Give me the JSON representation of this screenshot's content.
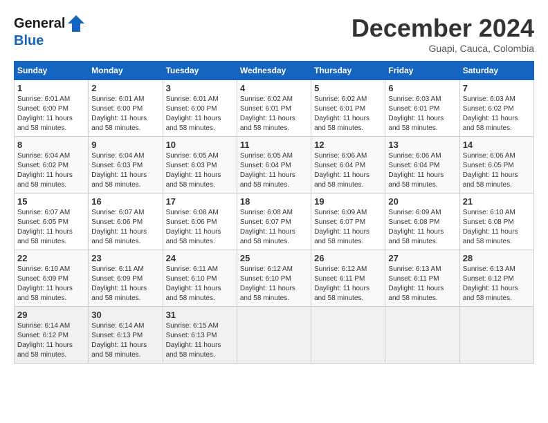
{
  "header": {
    "logo_line1": "General",
    "logo_line2": "Blue",
    "month_title": "December 2024",
    "location": "Guapi, Cauca, Colombia"
  },
  "days_of_week": [
    "Sunday",
    "Monday",
    "Tuesday",
    "Wednesday",
    "Thursday",
    "Friday",
    "Saturday"
  ],
  "weeks": [
    [
      {
        "day": "1",
        "sunrise": "6:01 AM",
        "sunset": "6:00 PM",
        "daylight": "11 hours and 58 minutes."
      },
      {
        "day": "2",
        "sunrise": "6:01 AM",
        "sunset": "6:00 PM",
        "daylight": "11 hours and 58 minutes."
      },
      {
        "day": "3",
        "sunrise": "6:01 AM",
        "sunset": "6:00 PM",
        "daylight": "11 hours and 58 minutes."
      },
      {
        "day": "4",
        "sunrise": "6:02 AM",
        "sunset": "6:01 PM",
        "daylight": "11 hours and 58 minutes."
      },
      {
        "day": "5",
        "sunrise": "6:02 AM",
        "sunset": "6:01 PM",
        "daylight": "11 hours and 58 minutes."
      },
      {
        "day": "6",
        "sunrise": "6:03 AM",
        "sunset": "6:01 PM",
        "daylight": "11 hours and 58 minutes."
      },
      {
        "day": "7",
        "sunrise": "6:03 AM",
        "sunset": "6:02 PM",
        "daylight": "11 hours and 58 minutes."
      }
    ],
    [
      {
        "day": "8",
        "sunrise": "6:04 AM",
        "sunset": "6:02 PM",
        "daylight": "11 hours and 58 minutes."
      },
      {
        "day": "9",
        "sunrise": "6:04 AM",
        "sunset": "6:03 PM",
        "daylight": "11 hours and 58 minutes."
      },
      {
        "day": "10",
        "sunrise": "6:05 AM",
        "sunset": "6:03 PM",
        "daylight": "11 hours and 58 minutes."
      },
      {
        "day": "11",
        "sunrise": "6:05 AM",
        "sunset": "6:04 PM",
        "daylight": "11 hours and 58 minutes."
      },
      {
        "day": "12",
        "sunrise": "6:06 AM",
        "sunset": "6:04 PM",
        "daylight": "11 hours and 58 minutes."
      },
      {
        "day": "13",
        "sunrise": "6:06 AM",
        "sunset": "6:04 PM",
        "daylight": "11 hours and 58 minutes."
      },
      {
        "day": "14",
        "sunrise": "6:06 AM",
        "sunset": "6:05 PM",
        "daylight": "11 hours and 58 minutes."
      }
    ],
    [
      {
        "day": "15",
        "sunrise": "6:07 AM",
        "sunset": "6:05 PM",
        "daylight": "11 hours and 58 minutes."
      },
      {
        "day": "16",
        "sunrise": "6:07 AM",
        "sunset": "6:06 PM",
        "daylight": "11 hours and 58 minutes."
      },
      {
        "day": "17",
        "sunrise": "6:08 AM",
        "sunset": "6:06 PM",
        "daylight": "11 hours and 58 minutes."
      },
      {
        "day": "18",
        "sunrise": "6:08 AM",
        "sunset": "6:07 PM",
        "daylight": "11 hours and 58 minutes."
      },
      {
        "day": "19",
        "sunrise": "6:09 AM",
        "sunset": "6:07 PM",
        "daylight": "11 hours and 58 minutes."
      },
      {
        "day": "20",
        "sunrise": "6:09 AM",
        "sunset": "6:08 PM",
        "daylight": "11 hours and 58 minutes."
      },
      {
        "day": "21",
        "sunrise": "6:10 AM",
        "sunset": "6:08 PM",
        "daylight": "11 hours and 58 minutes."
      }
    ],
    [
      {
        "day": "22",
        "sunrise": "6:10 AM",
        "sunset": "6:09 PM",
        "daylight": "11 hours and 58 minutes."
      },
      {
        "day": "23",
        "sunrise": "6:11 AM",
        "sunset": "6:09 PM",
        "daylight": "11 hours and 58 minutes."
      },
      {
        "day": "24",
        "sunrise": "6:11 AM",
        "sunset": "6:10 PM",
        "daylight": "11 hours and 58 minutes."
      },
      {
        "day": "25",
        "sunrise": "6:12 AM",
        "sunset": "6:10 PM",
        "daylight": "11 hours and 58 minutes."
      },
      {
        "day": "26",
        "sunrise": "6:12 AM",
        "sunset": "6:11 PM",
        "daylight": "11 hours and 58 minutes."
      },
      {
        "day": "27",
        "sunrise": "6:13 AM",
        "sunset": "6:11 PM",
        "daylight": "11 hours and 58 minutes."
      },
      {
        "day": "28",
        "sunrise": "6:13 AM",
        "sunset": "6:12 PM",
        "daylight": "11 hours and 58 minutes."
      }
    ],
    [
      {
        "day": "29",
        "sunrise": "6:14 AM",
        "sunset": "6:12 PM",
        "daylight": "11 hours and 58 minutes."
      },
      {
        "day": "30",
        "sunrise": "6:14 AM",
        "sunset": "6:13 PM",
        "daylight": "11 hours and 58 minutes."
      },
      {
        "day": "31",
        "sunrise": "6:15 AM",
        "sunset": "6:13 PM",
        "daylight": "11 hours and 58 minutes."
      },
      null,
      null,
      null,
      null
    ]
  ],
  "labels": {
    "sunrise": "Sunrise: ",
    "sunset": "Sunset: ",
    "daylight": "Daylight: "
  }
}
